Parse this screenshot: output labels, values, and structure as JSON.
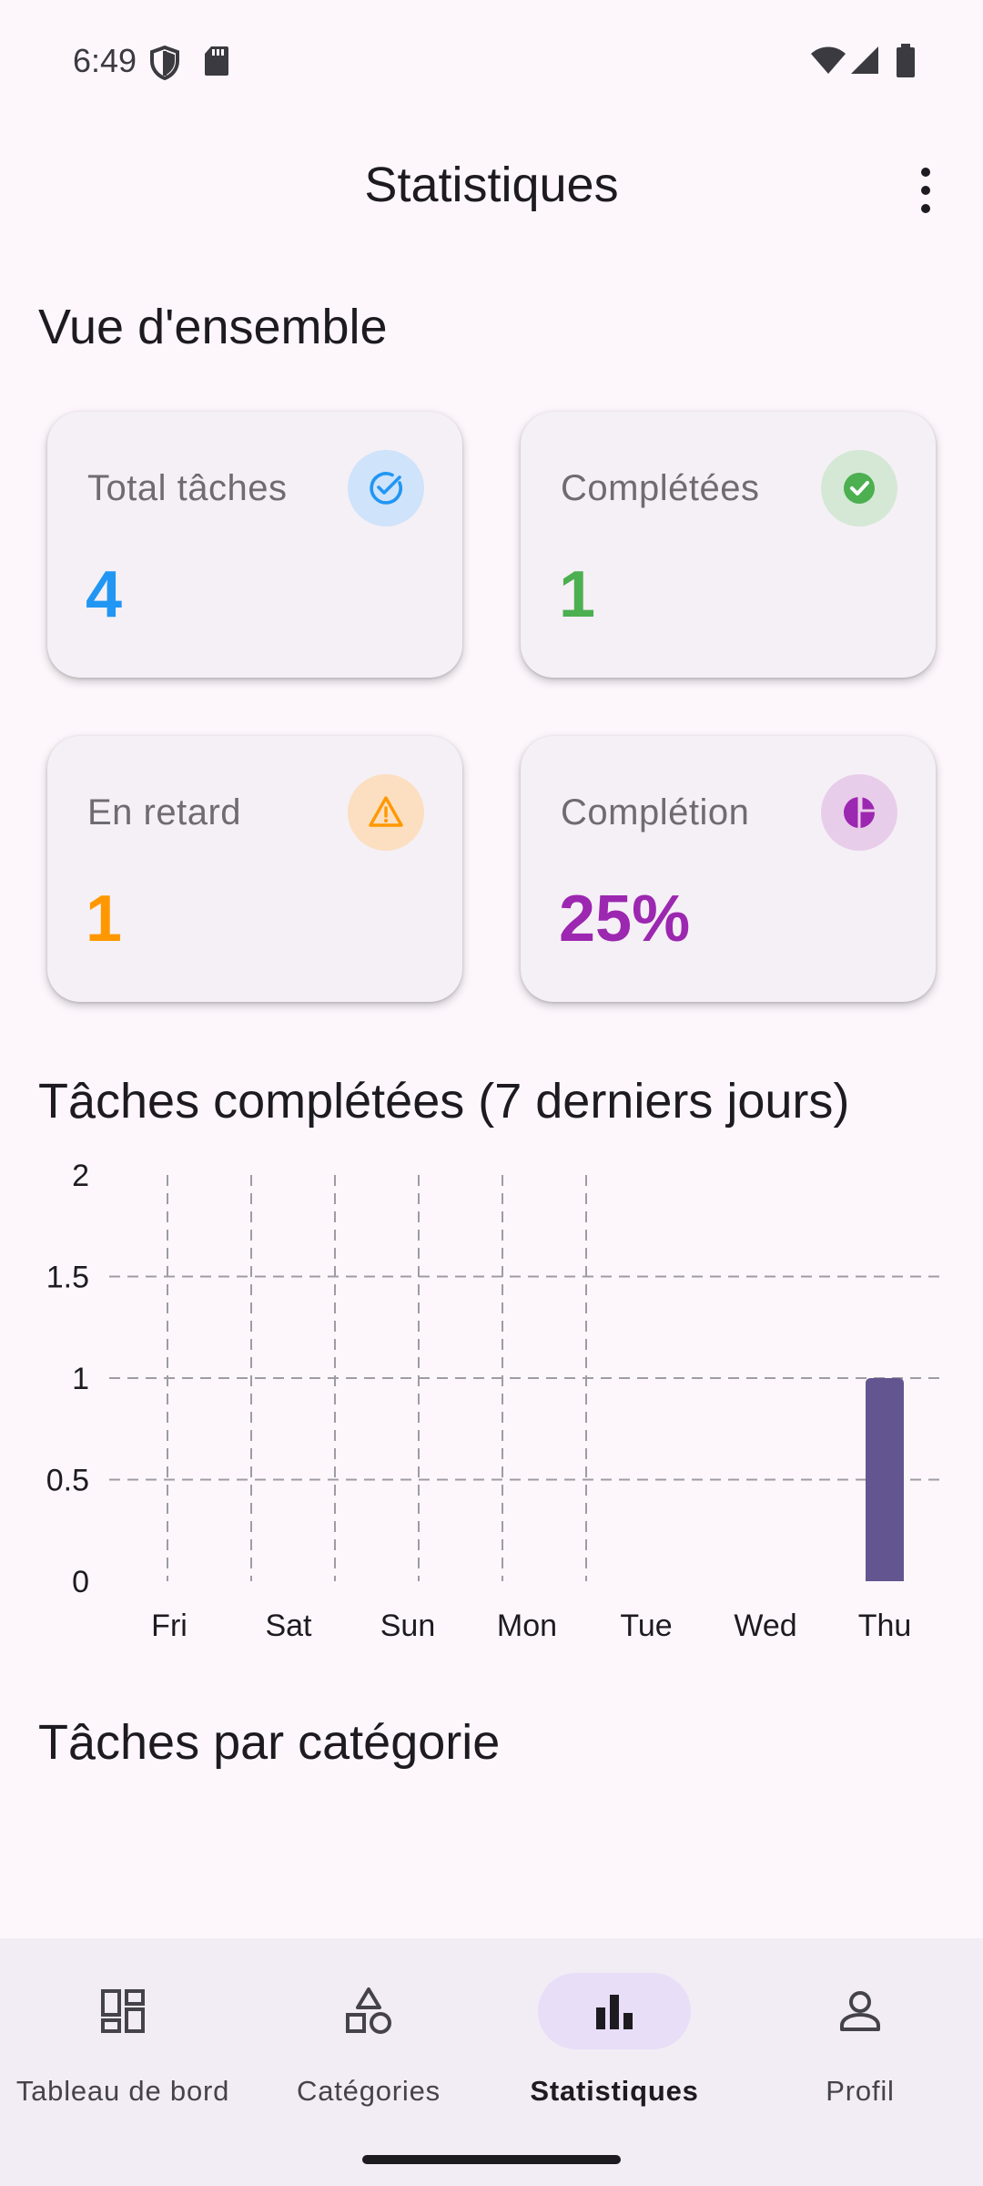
{
  "status_bar": {
    "time": "6:49",
    "icons": [
      "shield-icon",
      "sd-card-icon",
      "wifi-icon",
      "cellular-signal-icon",
      "battery-icon"
    ]
  },
  "app_bar": {
    "title": "Statistiques",
    "menu_icon": "more-vert-icon"
  },
  "overview": {
    "title": "Vue d'ensemble",
    "cards": [
      {
        "label": "Total tâches",
        "value": "4",
        "icon": "task-check-icon",
        "color": "#2196f3",
        "icon_bg": "#cfe3fb"
      },
      {
        "label": "Complétées",
        "value": "1",
        "icon": "check-circle-icon",
        "color": "#4caf50",
        "icon_bg": "#d4e8d5"
      },
      {
        "label": "En retard",
        "value": "1",
        "icon": "warning-icon",
        "color": "#ff9800",
        "icon_bg": "#fbdfc0"
      },
      {
        "label": "Complétion",
        "value": "25%",
        "icon": "pie-chart-icon",
        "color": "#9c27b0",
        "icon_bg": "#e8cdea"
      }
    ]
  },
  "completed_chart": {
    "title": "Tâches complétées (7 derniers jours)"
  },
  "chart_data": {
    "type": "bar",
    "title": "Tâches complétées (7 derniers jours)",
    "categories": [
      "Fri",
      "Sat",
      "Sun",
      "Mon",
      "Tue",
      "Wed",
      "Thu"
    ],
    "values": [
      0,
      0,
      0,
      0,
      0,
      0,
      1
    ],
    "y_ticks": [
      "0",
      "0.5",
      "1",
      "1.5",
      "2"
    ],
    "ylim": [
      0,
      2
    ],
    "grid": true,
    "bar_color": "#63558f"
  },
  "by_category": {
    "title": "Tâches par catégorie"
  },
  "bottom_nav": {
    "items": [
      {
        "label": "Tableau de bord",
        "icon": "dashboard-icon",
        "active": false
      },
      {
        "label": "Catégories",
        "icon": "category-shapes-icon",
        "active": false
      },
      {
        "label": "Statistiques",
        "icon": "bar-chart-icon",
        "active": true
      },
      {
        "label": "Profil",
        "icon": "person-icon",
        "active": false
      }
    ],
    "active_pill_color": "#e8def8"
  }
}
